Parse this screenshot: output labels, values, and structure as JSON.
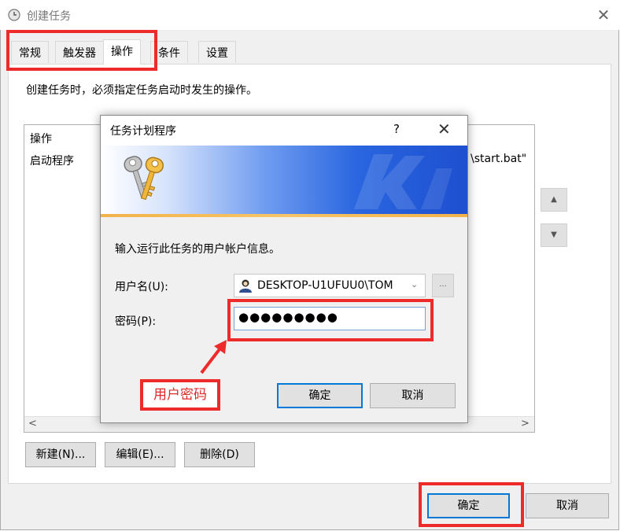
{
  "window": {
    "title": "创建任务",
    "close_glyph": "✕"
  },
  "tabs": [
    {
      "label": "常规",
      "active": false
    },
    {
      "label": "触发器",
      "active": false
    },
    {
      "label": "操作",
      "active": true
    },
    {
      "label": "条件",
      "active": false
    },
    {
      "label": "设置",
      "active": false
    }
  ],
  "panel": {
    "description": "创建任务时，必须指定任务启动时发生的操作。",
    "list": {
      "column_header": "操作",
      "rows": [
        {
          "action": "启动程序",
          "detail_fragment": "\\start.bat\""
        }
      ]
    },
    "scroll_left_glyph": "<",
    "scroll_right_glyph": ">",
    "move_up_glyph": "▲",
    "move_down_glyph": "▼",
    "buttons": {
      "new": "新建(N)...",
      "edit": "编辑(E)...",
      "delete": "删除(D)"
    }
  },
  "footer": {
    "ok": "确定",
    "cancel": "取消"
  },
  "dialog": {
    "title": "任务计划程序",
    "help_glyph": "?",
    "close_glyph": "✕",
    "prompt": "输入运行此任务的用户帐户信息。",
    "user_label": "用户名(U):",
    "user_value": "DESKTOP-U1UFUU0\\TOM",
    "combo_arrow_glyph": "⌄",
    "browse_label": "...",
    "password_label": "密码(P):",
    "password_value": "●●●●●●●●●",
    "ok": "确定",
    "cancel": "取消"
  },
  "annotation": {
    "label": "用户密码",
    "color": "#ee2b2b"
  },
  "icons": [
    "clock-icon",
    "keys-icon",
    "user-icon",
    "arrow-up-icon",
    "arrow-down-icon"
  ]
}
